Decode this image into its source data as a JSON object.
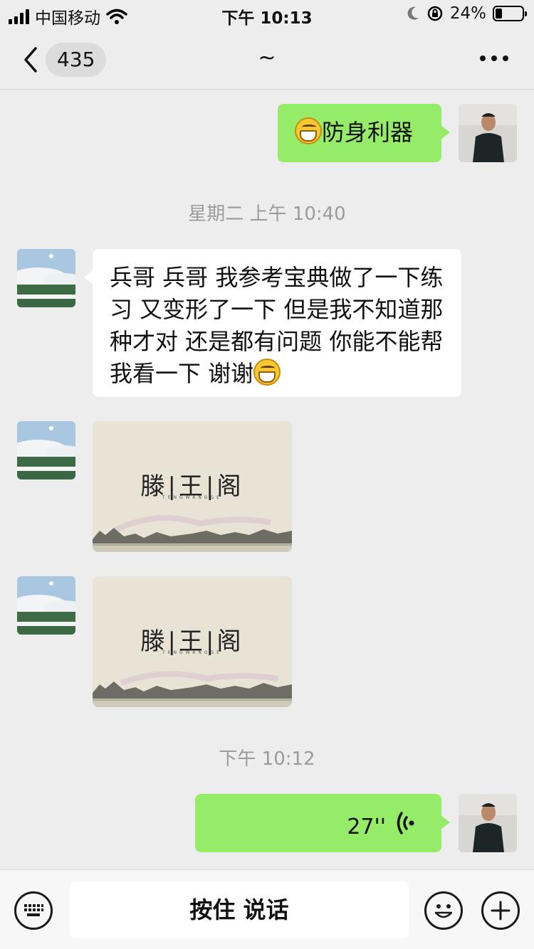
{
  "status_bar": {
    "carrier": "中国移动",
    "time": "下午 10:13",
    "battery": "24%",
    "battery_level": 0.24
  },
  "header": {
    "unread_count": "435",
    "title": "~"
  },
  "messages": {
    "m1": {
      "text": "防身利器"
    },
    "ts1": "星期二 上午 10:40",
    "m2": {
      "text": "兵哥 兵哥 我参考宝典做了一下练习 又变形了一下 但是我不知道那种才对 还是都有问题 你能不能帮我看一下 谢谢"
    },
    "img1": {
      "title": "滕|王|阁",
      "subtitle": "TENGWANGGE"
    },
    "img2": {
      "title": "滕|王|阁",
      "subtitle": "TENGWANGGE"
    },
    "ts2": "下午 10:12",
    "voice": {
      "duration": "27''"
    }
  },
  "input_bar": {
    "hold_to_talk": "按住 说话"
  },
  "colors": {
    "background": "#ededed",
    "sent_bubble": "#95ec69",
    "received_bubble": "#ffffff",
    "timestamp": "#9b9b9b"
  },
  "icons": [
    "signal-icon",
    "wifi-icon",
    "moon-icon",
    "rotation-lock-icon",
    "battery-icon",
    "back-chevron-icon",
    "more-icon",
    "grin-emoji-icon",
    "voice-wave-icon",
    "keyboard-icon",
    "emoji-icon",
    "plus-icon"
  ]
}
